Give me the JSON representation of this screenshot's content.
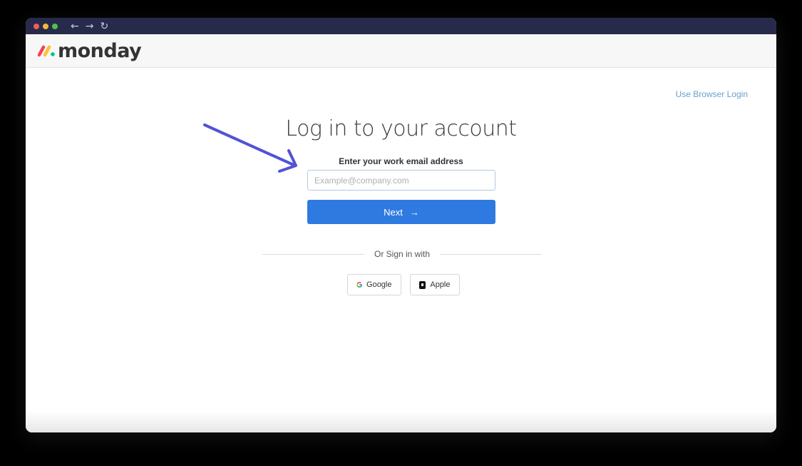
{
  "browser": {
    "nav": {
      "back_icon": "←",
      "forward_icon": "→",
      "reload_icon": "↻"
    }
  },
  "app": {
    "brand": "monday",
    "brand_colors": [
      "#f63f5c",
      "#fdc131",
      "#00c774"
    ]
  },
  "login": {
    "browser_login_link": "Use Browser Login",
    "title": "Log in to your account",
    "email_label": "Enter your work email address",
    "email_value": "",
    "email_placeholder": "Example@company.com",
    "next_label": "Next",
    "next_icon": "→",
    "divider_text": "Or Sign in with",
    "social": [
      {
        "label": "Google",
        "icon": "google-icon"
      },
      {
        "label": "Apple",
        "icon": "apple-icon"
      }
    ]
  },
  "annotation": {
    "arrow_color": "#5252d6",
    "points_to": "email-input"
  },
  "colors": {
    "primary": "#2f7ae0",
    "titlebar": "#272a4a",
    "link": "#6aa0c9"
  }
}
